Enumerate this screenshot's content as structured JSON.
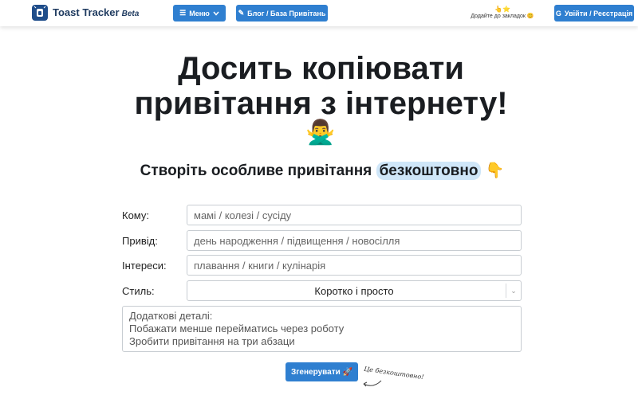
{
  "header": {
    "brand": "Toast Tracker",
    "beta": "Beta",
    "menu_label": "Меню",
    "blog_label": "Блог / База Привітань",
    "bookmark_stars": "👆⭐",
    "bookmark_text": "Додайте до закладок 😊",
    "login_label": "Увійти / Реєстрація",
    "icons": [
      "toast-logo-icon",
      "hamburger-icon",
      "chevron-down-icon",
      "edit-icon",
      "google-icon"
    ]
  },
  "hero": {
    "title_line1": "Досить копіювати",
    "title_line2": "привітання з інтернету!",
    "emoji": "🙅‍♂️",
    "subtitle_prefix": "Створіть особливе привітання ",
    "subtitle_highlight": "безкоштовно",
    "subtitle_emoji": "👇"
  },
  "form": {
    "to_label": "Кому:",
    "to_placeholder": "мамі / колезі / сусіду",
    "occasion_label": "Привід:",
    "occasion_placeholder": "день народження / підвищення / новосілля",
    "interests_label": "Інтереси:",
    "interests_placeholder": "плавання / книги / кулінарія",
    "style_label": "Стиль:",
    "style_value": "Коротко і просто",
    "details_line1": "Додаткові деталі:",
    "details_line2": "Побажати менше перейматись через роботу",
    "details_line3": "Зробити привітання на три абзаци",
    "generate_label": "Згенерувати 🚀",
    "free_note": "Це безкоштовно!"
  },
  "colors": {
    "accent": "#2f7fd0",
    "brand": "#1e3a5f",
    "highlight": "#cfe6f8"
  }
}
